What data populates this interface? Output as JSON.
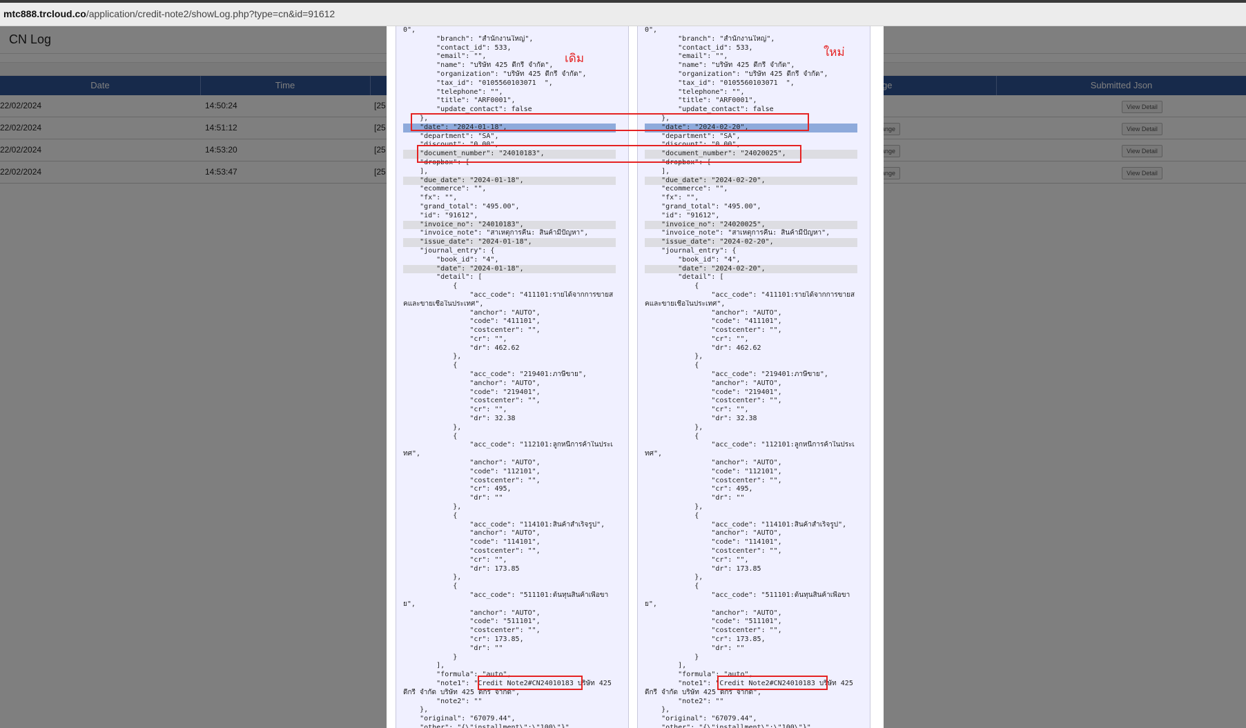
{
  "browser": {
    "url_host": "mtc888.trcloud.co",
    "url_path": "/application/credit-note2/showLog.php?type=cn&id=91612"
  },
  "page": {
    "title": "CN Log",
    "columns": [
      "Date",
      "Time",
      "ge",
      "Submitted Json"
    ],
    "rows": [
      {
        "date": "22/02/2024",
        "time": "14:50:24",
        "partial": "[25",
        "change": "",
        "view": "View Detail"
      },
      {
        "date": "22/02/2024",
        "time": "14:51:12",
        "partial": "[25",
        "change": "ange",
        "view": "View Detail"
      },
      {
        "date": "22/02/2024",
        "time": "14:53:20",
        "partial": "[25",
        "change": "ange",
        "view": "View Detail"
      },
      {
        "date": "22/02/2024",
        "time": "14:53:47",
        "partial": "[25",
        "change": "ange",
        "view": "View Detail"
      }
    ]
  },
  "modal": {
    "label_old": "เดิม",
    "label_new": "ใหม่",
    "left_lines": [
      {
        "t": "0\","
      },
      {
        "t": "        \"branch\": \"สำนักงานใหญ่\","
      },
      {
        "t": "        \"contact_id\": 533,"
      },
      {
        "t": "        \"email\": \"\","
      },
      {
        "t": "        \"name\": \"บริษัท 425 ดีกรี จำกัด\","
      },
      {
        "t": "        \"organization\": \"บริษัท 425 ดีกรี จำกัด\","
      },
      {
        "t": "        \"tax_id\": \"0105560103071  \","
      },
      {
        "t": "        \"telephone\": \"\","
      },
      {
        "t": "        \"title\": \"ARF0001\","
      },
      {
        "t": "        \"update_contact\": false"
      },
      {
        "t": "    },"
      },
      {
        "t": "    \"date\": \"2024-01-18\",",
        "h": "b"
      },
      {
        "t": "    \"department\": \"SA\","
      },
      {
        "t": "    \"discount\": \"0.00\","
      },
      {
        "t": "    \"document_number\": \"24010183\",",
        "h": "g"
      },
      {
        "t": "    \"dropbox\": ["
      },
      {
        "t": "    ],"
      },
      {
        "t": "    \"due_date\": \"2024-01-18\",",
        "h": "g"
      },
      {
        "t": "    \"ecommerce\": \"\","
      },
      {
        "t": "    \"fx\": \"\","
      },
      {
        "t": "    \"grand_total\": \"495.00\","
      },
      {
        "t": "    \"id\": \"91612\","
      },
      {
        "t": "    \"invoice_no\": \"24010183\",",
        "h": "g"
      },
      {
        "t": "    \"invoice_note\": \"สาเหตุการคืน: สินค้ามีปัญหา\","
      },
      {
        "t": "    \"issue_date\": \"2024-01-18\",",
        "h": "g"
      },
      {
        "t": "    \"journal_entry\": {"
      },
      {
        "t": "        \"book_id\": \"4\","
      },
      {
        "t": "        \"date\": \"2024-01-18\",",
        "h": "g"
      },
      {
        "t": "        \"detail\": ["
      },
      {
        "t": "            {"
      },
      {
        "t": "                \"acc_code\": \"411101:รายได้จากการขายส"
      },
      {
        "t": "คและขายเชื่อในประเทศ\","
      },
      {
        "t": "                \"anchor\": \"AUTO\","
      },
      {
        "t": "                \"code\": \"411101\","
      },
      {
        "t": "                \"costcenter\": \"\","
      },
      {
        "t": "                \"cr\": \"\","
      },
      {
        "t": "                \"dr\": 462.62"
      },
      {
        "t": "            },"
      },
      {
        "t": "            {"
      },
      {
        "t": "                \"acc_code\": \"219401:ภาษีขาย\","
      },
      {
        "t": "                \"anchor\": \"AUTO\","
      },
      {
        "t": "                \"code\": \"219401\","
      },
      {
        "t": "                \"costcenter\": \"\","
      },
      {
        "t": "                \"cr\": \"\","
      },
      {
        "t": "                \"dr\": 32.38"
      },
      {
        "t": "            },"
      },
      {
        "t": "            {"
      },
      {
        "t": "                \"acc_code\": \"112101:ลูกหนี้การค้าในประเ"
      },
      {
        "t": "ทศ\","
      },
      {
        "t": "                \"anchor\": \"AUTO\","
      },
      {
        "t": "                \"code\": \"112101\","
      },
      {
        "t": "                \"costcenter\": \"\","
      },
      {
        "t": "                \"cr\": 495,"
      },
      {
        "t": "                \"dr\": \"\""
      },
      {
        "t": "            },"
      },
      {
        "t": "            {"
      },
      {
        "t": "                \"acc_code\": \"114101:สินค้าสำเร็จรูป\","
      },
      {
        "t": "                \"anchor\": \"AUTO\","
      },
      {
        "t": "                \"code\": \"114101\","
      },
      {
        "t": "                \"costcenter\": \"\","
      },
      {
        "t": "                \"cr\": \"\","
      },
      {
        "t": "                \"dr\": 173.85"
      },
      {
        "t": "            },"
      },
      {
        "t": "            {"
      },
      {
        "t": "                \"acc_code\": \"511101:ต้นทุนสินค้าเพื่อขา"
      },
      {
        "t": "ย\","
      },
      {
        "t": "                \"anchor\": \"AUTO\","
      },
      {
        "t": "                \"code\": \"511101\","
      },
      {
        "t": "                \"costcenter\": \"\","
      },
      {
        "t": "                \"cr\": 173.85,"
      },
      {
        "t": "                \"dr\": \"\""
      },
      {
        "t": "            }"
      },
      {
        "t": "        ],"
      },
      {
        "t": "        \"formula\": \"auto\","
      },
      {
        "t": "        \"note1\": \"Credit Note2#CN24010183 บริษัท 425"
      },
      {
        "t": "ดีกรี จำกัด บริษัท 425 ดีกรี จำกัด\","
      },
      {
        "t": "        \"note2\": \"\""
      },
      {
        "t": "    },"
      },
      {
        "t": "    \"original\": \"67079.44\","
      },
      {
        "t": "    \"other\": \"{\\\"installment\\\":\\\"100\\\"}\","
      }
    ],
    "right_lines": [
      {
        "t": "0\","
      },
      {
        "t": "        \"branch\": \"สำนักงานใหญ่\","
      },
      {
        "t": "        \"contact_id\": 533,"
      },
      {
        "t": "        \"email\": \"\","
      },
      {
        "t": "        \"name\": \"บริษัท 425 ดีกรี จำกัด\","
      },
      {
        "t": "        \"organization\": \"บริษัท 425 ดีกรี จำกัด\","
      },
      {
        "t": "        \"tax_id\": \"0105560103071  \","
      },
      {
        "t": "        \"telephone\": \"\","
      },
      {
        "t": "        \"title\": \"ARF0001\","
      },
      {
        "t": "        \"update_contact\": false"
      },
      {
        "t": "    },"
      },
      {
        "t": "    \"date\": \"2024-02-20\",",
        "h": "b"
      },
      {
        "t": "    \"department\": \"SA\","
      },
      {
        "t": "    \"discount\": \"0.00\","
      },
      {
        "t": "    \"document_number\": \"24020025\",",
        "h": "g"
      },
      {
        "t": "    \"dropbox\": ["
      },
      {
        "t": "    ],"
      },
      {
        "t": "    \"due_date\": \"2024-02-20\",",
        "h": "g"
      },
      {
        "t": "    \"ecommerce\": \"\","
      },
      {
        "t": "    \"fx\": \"\","
      },
      {
        "t": "    \"grand_total\": \"495.00\","
      },
      {
        "t": "    \"id\": \"91612\","
      },
      {
        "t": "    \"invoice_no\": \"24020025\",",
        "h": "g"
      },
      {
        "t": "    \"invoice_note\": \"สาเหตุการคืน: สินค้ามีปัญหา\","
      },
      {
        "t": "    \"issue_date\": \"2024-02-20\",",
        "h": "g"
      },
      {
        "t": "    \"journal_entry\": {"
      },
      {
        "t": "        \"book_id\": \"4\","
      },
      {
        "t": "        \"date\": \"2024-02-20\",",
        "h": "g"
      },
      {
        "t": "        \"detail\": ["
      },
      {
        "t": "            {"
      },
      {
        "t": "                \"acc_code\": \"411101:รายได้จากการขายส"
      },
      {
        "t": "คและขายเชื่อในประเทศ\","
      },
      {
        "t": "                \"anchor\": \"AUTO\","
      },
      {
        "t": "                \"code\": \"411101\","
      },
      {
        "t": "                \"costcenter\": \"\","
      },
      {
        "t": "                \"cr\": \"\","
      },
      {
        "t": "                \"dr\": 462.62"
      },
      {
        "t": "            },"
      },
      {
        "t": "            {"
      },
      {
        "t": "                \"acc_code\": \"219401:ภาษีขาย\","
      },
      {
        "t": "                \"anchor\": \"AUTO\","
      },
      {
        "t": "                \"code\": \"219401\","
      },
      {
        "t": "                \"costcenter\": \"\","
      },
      {
        "t": "                \"cr\": \"\","
      },
      {
        "t": "                \"dr\": 32.38"
      },
      {
        "t": "            },"
      },
      {
        "t": "            {"
      },
      {
        "t": "                \"acc_code\": \"112101:ลูกหนี้การค้าในประเ"
      },
      {
        "t": "ทศ\","
      },
      {
        "t": "                \"anchor\": \"AUTO\","
      },
      {
        "t": "                \"code\": \"112101\","
      },
      {
        "t": "                \"costcenter\": \"\","
      },
      {
        "t": "                \"cr\": 495,"
      },
      {
        "t": "                \"dr\": \"\""
      },
      {
        "t": "            },"
      },
      {
        "t": "            {"
      },
      {
        "t": "                \"acc_code\": \"114101:สินค้าสำเร็จรูป\","
      },
      {
        "t": "                \"anchor\": \"AUTO\","
      },
      {
        "t": "                \"code\": \"114101\","
      },
      {
        "t": "                \"costcenter\": \"\","
      },
      {
        "t": "                \"cr\": \"\","
      },
      {
        "t": "                \"dr\": 173.85"
      },
      {
        "t": "            },"
      },
      {
        "t": "            {"
      },
      {
        "t": "                \"acc_code\": \"511101:ต้นทุนสินค้าเพื่อขา"
      },
      {
        "t": "ย\","
      },
      {
        "t": "                \"anchor\": \"AUTO\","
      },
      {
        "t": "                \"code\": \"511101\","
      },
      {
        "t": "                \"costcenter\": \"\","
      },
      {
        "t": "                \"cr\": 173.85,"
      },
      {
        "t": "                \"dr\": \"\""
      },
      {
        "t": "            }"
      },
      {
        "t": "        ],"
      },
      {
        "t": "        \"formula\": \"auto\","
      },
      {
        "t": "        \"note1\": \"Credit Note2#CN24010183 บริษัท 425"
      },
      {
        "t": "ดีกรี จำกัด บริษัท 425 ดีกรี จำกัด\","
      },
      {
        "t": "        \"note2\": \"\""
      },
      {
        "t": "    },"
      },
      {
        "t": "    \"original\": \"67079.44\","
      },
      {
        "t": "    \"other\": \"{\\\"installment\\\":\\\"100\\\"}\","
      }
    ]
  },
  "colors": {
    "header_blue": "#2f5597",
    "highlight_blue": "#8eaadb",
    "highlight_gray": "#dddde2",
    "annotation_red": "#e52222",
    "pane_bg": "#f0f0ff"
  }
}
